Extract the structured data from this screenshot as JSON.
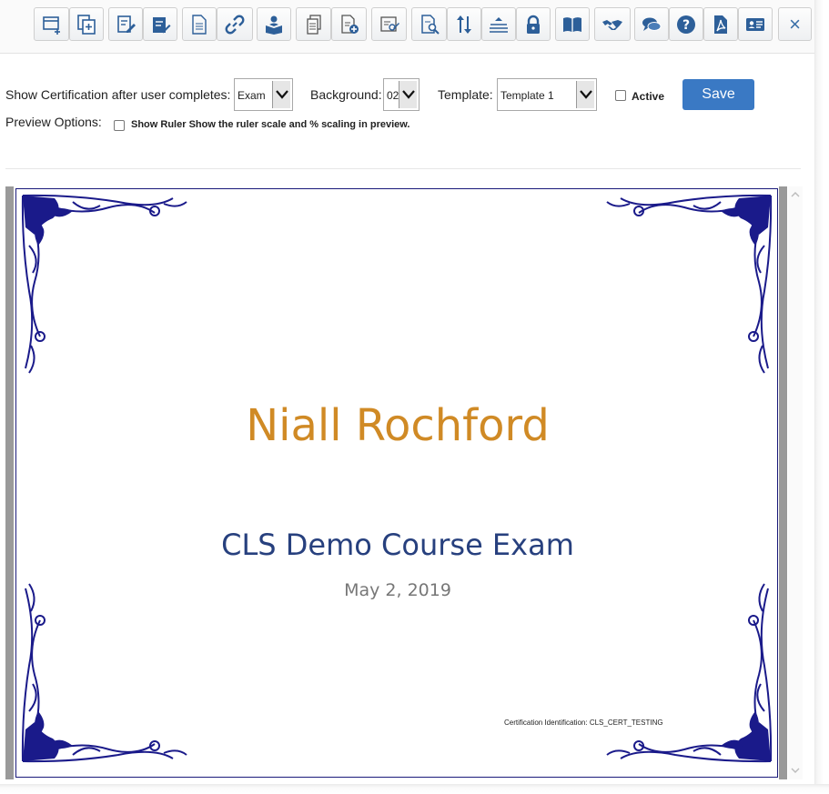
{
  "toolbar": {
    "buttons": [
      {
        "icon": "window-add-icon"
      },
      {
        "icon": "copy-add-icon"
      },
      {
        "icon": "edit-document-icon"
      },
      {
        "icon": "notepad-edit-icon"
      },
      {
        "icon": "document-icon"
      },
      {
        "icon": "link-icon"
      },
      {
        "icon": "reader-icon"
      },
      {
        "icon": "document-list-icon"
      },
      {
        "icon": "document-add-icon"
      },
      {
        "icon": "certificate-edit-icon"
      },
      {
        "icon": "document-search-icon"
      },
      {
        "icon": "sort-arrows-icon"
      },
      {
        "icon": "stack-icon"
      },
      {
        "icon": "lock-icon"
      },
      {
        "icon": "book-icon"
      },
      {
        "icon": "handshake-icon"
      },
      {
        "icon": "chat-icon"
      },
      {
        "icon": "help-icon"
      },
      {
        "icon": "pdf-icon"
      },
      {
        "icon": "id-card-icon"
      }
    ],
    "close_glyph": "×",
    "accent": "#3a6fa8"
  },
  "settings": {
    "show_after_label": "Show Certification after user completes:",
    "show_after_value": "Exam",
    "background_label": "Background:",
    "background_value": "02",
    "template_label": "Template:",
    "template_value": "Template 1",
    "active_label": "Active",
    "active_checked": false,
    "save_label": "Save",
    "save_color": "#3a79c4"
  },
  "preview_options": {
    "label": "Preview Options:",
    "show_ruler_label": "Show Ruler",
    "show_ruler_desc": "Show the ruler scale and % scaling in preview.",
    "show_ruler_checked": false
  },
  "certificate": {
    "name": "Niall Rochford",
    "course": "CLS Demo Course Exam",
    "date": "May 2, 2019",
    "identification": "Certification Identification: CLS_CERT_TESTING",
    "name_color": "#d08a25",
    "course_color": "#27407e",
    "ornament_color": "#1a1a8a"
  }
}
